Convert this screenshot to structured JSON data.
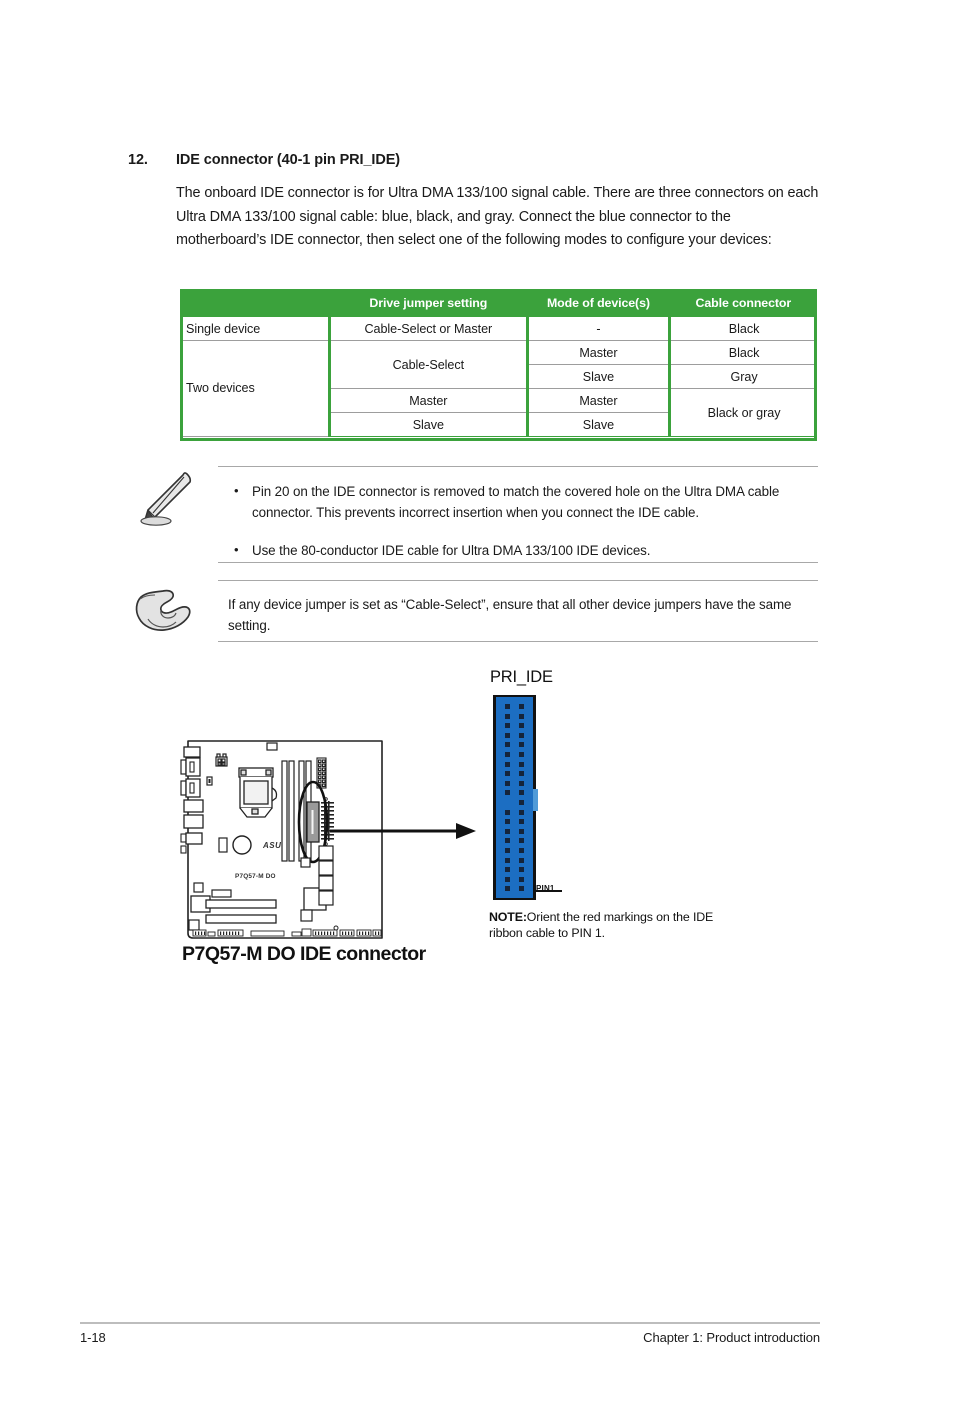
{
  "section": {
    "number": "12.",
    "title": "IDE connector (40-1 pin PRI_IDE)",
    "body": "The onboard IDE connector is for Ultra DMA 133/100 signal cable. There are three connectors on each Ultra DMA 133/100 signal cable: blue, black, and gray. Connect the blue connector to the motherboard’s IDE connector, then select one of the following modes to configure your devices:"
  },
  "table": {
    "headers": [
      "",
      "Drive jumper setting",
      "Mode of device(s)",
      "Cable connector"
    ],
    "rows": [
      {
        "device": "Single device",
        "jumper": "Cable-Select or Master",
        "mode": "-",
        "cable": "Black"
      },
      {
        "device": "Two devices",
        "jumper": "Cable-Select",
        "mode": "Master",
        "cable": "Black"
      },
      {
        "device": "",
        "jumper": "",
        "mode": "Slave",
        "cable": "Gray"
      },
      {
        "device": "",
        "jumper": "Master",
        "mode": "Master",
        "cable": "Black or gray"
      },
      {
        "device": "",
        "jumper": "Slave",
        "mode": "Slave",
        "cable": ""
      }
    ],
    "accent_color": "#3ba23c",
    "header_text_color": "#ffffff"
  },
  "notes": [
    {
      "icon": "pencil-note-icon",
      "bullets": [
        "Pin 20 on the IDE connector is removed to match the covered hole on the Ultra DMA cable connector. This prevents incorrect insertion when you connect the IDE cable.",
        "Use the 80-conductor IDE cable for Ultra DMA 133/100 IDE devices."
      ],
      "bullet_char": "•"
    },
    {
      "icon": "pointing-hand-icon",
      "bullets": [
        "If any device jumper is set as “Cable-Select”, ensure that all other device jumpers have the same setting."
      ],
      "bullet_char": ""
    }
  ],
  "diagram": {
    "connector_label": "PRI_IDE",
    "pin1_label": "PIN1",
    "note_prefix": "NOTE:",
    "note_text": "Orient the red markings on the IDE ribbon cable to PIN 1.",
    "board_silkscreen": "P7Q57-M DO",
    "board_logo": "ASUS",
    "caption": "P7Q57-M DO IDE connector",
    "connector_color": "#1c6ec2",
    "pin_rows": 20,
    "missing_pin": "left column, row 11"
  },
  "footer": {
    "page_number": "1-18",
    "chapter": "Chapter 1: Product introduction"
  }
}
